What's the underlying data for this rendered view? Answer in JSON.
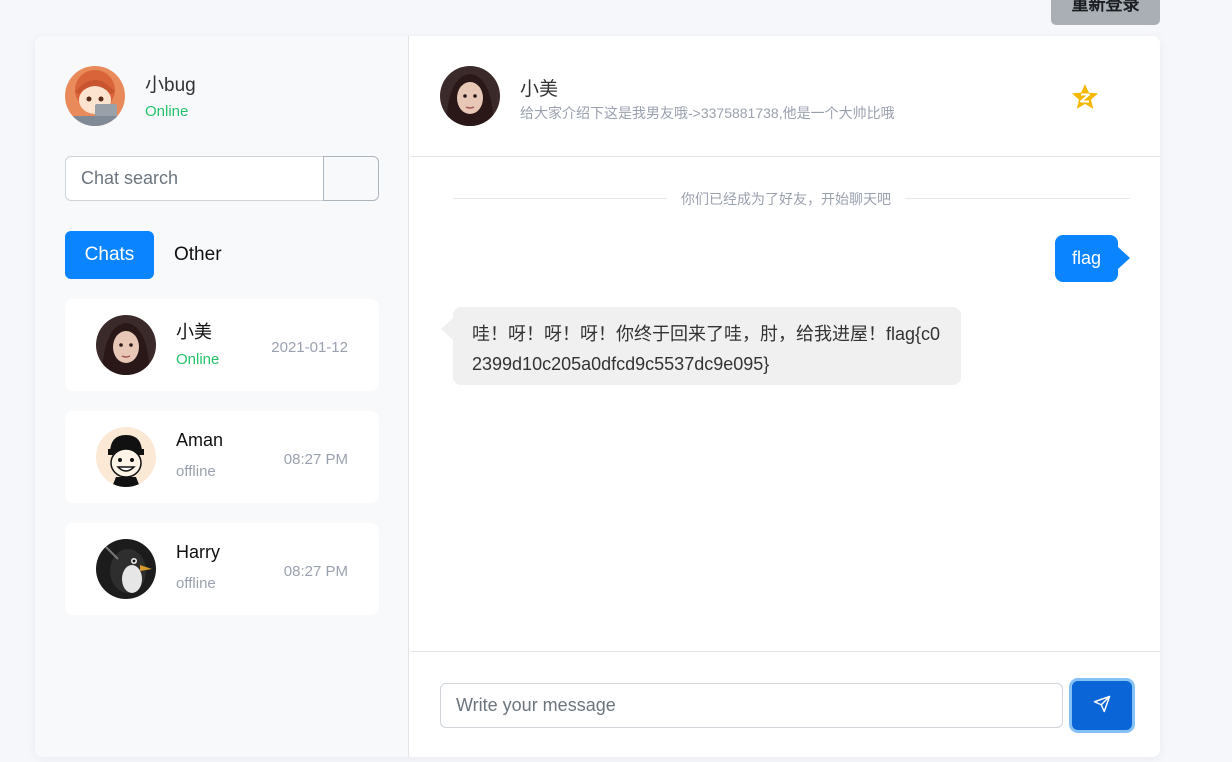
{
  "top_button": {
    "label": "重新登录"
  },
  "me": {
    "name": "小bug",
    "status": "Online"
  },
  "search": {
    "placeholder": "Chat search"
  },
  "tabs": {
    "chats": "Chats",
    "other": "Other"
  },
  "chats": [
    {
      "name": "小美",
      "status": "Online",
      "time": "2021-01-12"
    },
    {
      "name": "Aman",
      "status": "offline",
      "time": "08:27 PM"
    },
    {
      "name": "Harry",
      "status": "offline",
      "time": "08:27 PM"
    }
  ],
  "conversation": {
    "name": "小美",
    "subtitle": "给大家介绍下这是我男友哦->3375881738,他是一个大帅比哦",
    "system_notice": "你们已经成为了好友，开始聊天吧",
    "messages": [
      {
        "direction": "out",
        "text": "flag"
      },
      {
        "direction": "in",
        "text": "哇！呀！呀！呀！你终于回来了哇，肘，给我进屋！flag{c02399d10c205a0dfcd9c5537dc9e095}"
      }
    ]
  },
  "composer": {
    "placeholder": "Write your message"
  },
  "colors": {
    "accent": "#0a84ff",
    "online": "#25c26a",
    "star": "#f5b800"
  },
  "icons": {
    "star": "star-icon",
    "send": "send-icon"
  }
}
